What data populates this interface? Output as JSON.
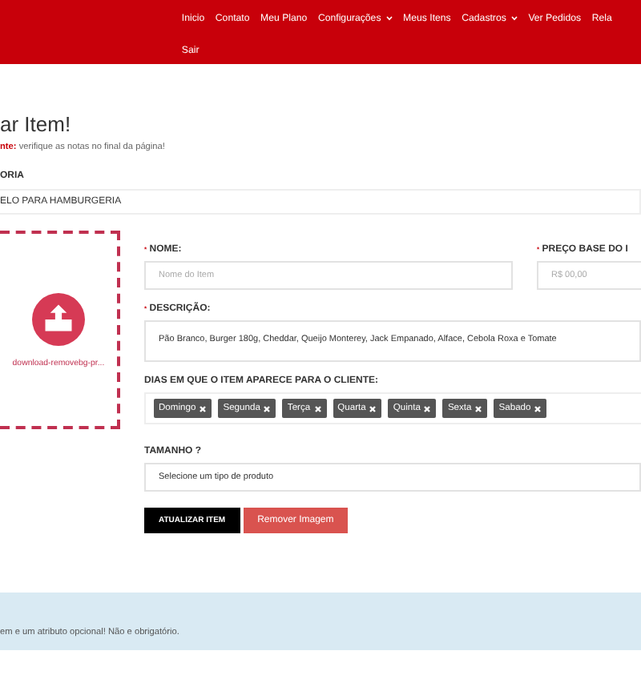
{
  "nav": {
    "items": [
      {
        "label": "Inicio",
        "dropdown": false
      },
      {
        "label": "Contato",
        "dropdown": false
      },
      {
        "label": "Meu Plano",
        "dropdown": false
      },
      {
        "label": "Configurações",
        "dropdown": true
      },
      {
        "label": "Meus Itens",
        "dropdown": false
      },
      {
        "label": "Cadastros",
        "dropdown": true
      },
      {
        "label": "Ver Pedidos",
        "dropdown": false
      },
      {
        "label": "Rela",
        "dropdown": false
      },
      {
        "label": "Sair",
        "dropdown": false
      }
    ]
  },
  "page": {
    "title": "ar Item!",
    "note_prefix": "nte:",
    "note": "verifique as notas no final da página!"
  },
  "category": {
    "label": "ORIA",
    "value": "ELO PARA HAMBURGERIA"
  },
  "upload": {
    "filename": "download-removebg-pr..."
  },
  "form": {
    "name_mark": "*",
    "price_mark": "*",
    "description_mark": "*",
    "name_label": "NOME:",
    "name_placeholder": "Nome do Item",
    "price_label": "PREÇO BASE DO I",
    "price_placeholder": "R$ 00,00",
    "description_label": "DESCRIÇÃO:",
    "description": "Pão Branco, Burger 180g, Cheddar, Queijo Monterey, Jack Empanado, Alface, Cebola Roxa e Tomate",
    "days_label": "DIAS EM QUE O ITEM APARECE PARA O CLIENTE:",
    "days": [
      "Domingo",
      "Segunda",
      "Terça",
      "Quarta",
      "Quinta",
      "Sexta",
      "Sabado"
    ],
    "size_label": "TAMANHO ?",
    "size_placeholder": "Selecione um tipo de produto"
  },
  "buttons": [
    {
      "label": "ATUALIZAR ITEM",
      "kind": "primary"
    },
    {
      "label": "Remover Imagem",
      "kind": "danger"
    }
  ],
  "info": {
    "text": "em e um atributo opcional! Não e obrigatório."
  }
}
